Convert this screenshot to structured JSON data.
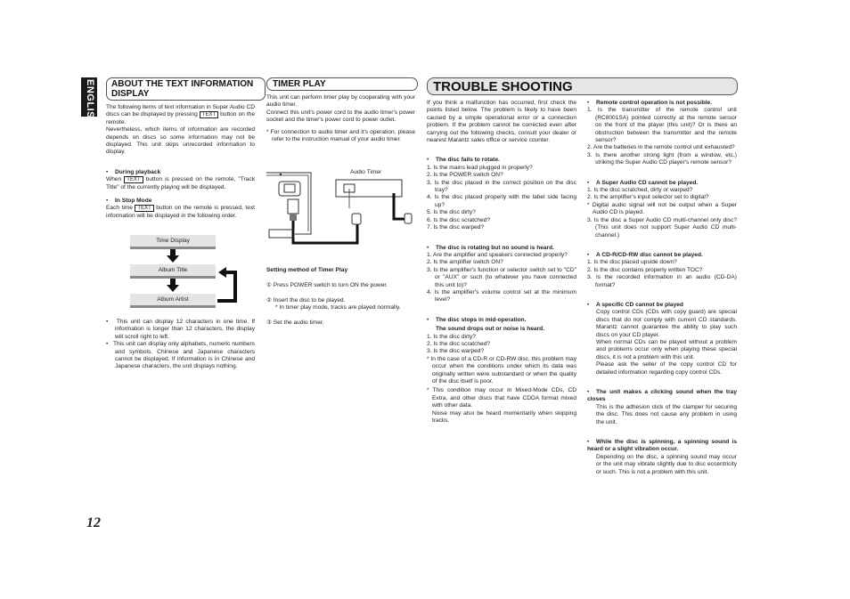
{
  "side_tab": {
    "label": "ENGLISH"
  },
  "page_number": "12",
  "text_info": {
    "title": "ABOUT THE TEXT INFORMATION DISPLAY",
    "intro_1a": "The following items of text information in Super Audio CD discs can be displayed by pressing",
    "key": "TEXT",
    "intro_1b": "button on the remote.",
    "intro_2": "Nevertheless, which items of information are recorded depends on discs so some information may not be displayed. This unit skips unrecorded information to display.",
    "playback_title": "During playback",
    "playback_a": "When",
    "playback_b": "button is pressed on the remote, \"Track Title\" of the currently playing will be displayed.",
    "stop_title": "In Stop Mode",
    "stop_a": "Each time",
    "stop_b": "button on the remote is pressed, text information will be displayed in the following order.",
    "flow": [
      "Time Display",
      "Album Title",
      "Album Artist"
    ],
    "notes": [
      "This unit can display 12 characters in one time. If information is longer than 12 characters, the display will scroll right to left.",
      "This unit can display only alphabets, numeric numbers and symbols. Chinese and Japanese characters cannot be displayed. If information is in Chinese and Japanese characters, the unit displays nothing."
    ]
  },
  "timer_play": {
    "title": "TIMER PLAY",
    "intro_1": "This unit can perform timer play by cooperating with your audio timer.",
    "intro_2": "Connect this unit's power cord to the audio timer's power socket and the timer's power cord to power outlet.",
    "note": "* For connection to audio timer and it's operation, please refer to the instruction manual of your audio timer.",
    "diagram_label": "Audio Timer",
    "method_title": "Setting method of Timer Play",
    "steps": [
      {
        "num": "①",
        "text": "Press POWER switch to turn ON the power."
      },
      {
        "num": "②",
        "text": "Insert the disc to be played."
      },
      {
        "num": "③",
        "text": "Set the audio timer."
      }
    ],
    "step2_note": "* In timer play mode, tracks are played normally."
  },
  "trouble": {
    "title": "TROUBLE SHOOTING",
    "intro": "If you think a malfunction has occurred, first check the points listed below. The problem is likely to have been caused by a simple operational error or a connection problem. If the problem cannot be corrected even after carrying out the following checks, consult your dealer or nearest Marantz sales office or service counter.",
    "s1": {
      "title": "The disc fails to rotate.",
      "items": [
        "1. Is the mains lead plugged in properly?",
        "2. Is the POWER switch ON?",
        "3. Is the disc placed in the correct position on the disc tray?",
        "4. Is the disc placed properly with the label side facing up?",
        "5. Is the disc dirty?",
        "6. Is the disc scratched?",
        "7. Is the disc warped?"
      ]
    },
    "s2": {
      "title": "The disc is rotating but no sound is heard.",
      "items": [
        "1. Are the amplifier and speakers connected properly?",
        "2. Is the amplifier switch ON?",
        "3. Is the amplifier's function or selector switch set to \"CD\" or \"AUX\" or such (to whatever you have connected this unit to)?",
        "4. Is the amplifier's volume control set at the minimum level?"
      ]
    },
    "s3": {
      "title": "The disc stops in mid-operation.",
      "title2": "The sound drops out or noise is heard.",
      "items": [
        "1. Is the disc dirty?",
        "2. Is the disc scratched?",
        "3. Is the disc warped?"
      ],
      "notes": [
        "* In the case of a CD-R or CD-RW disc, this problem may occur when the conditions under which its data was originally written were substandard or when the quality of the disc itself is poor.",
        "* This condition may occur in Mixed-Mode CDs, CD Extra, and other discs that have CDDA format mixed with other data."
      ],
      "extra": "Noise may also be heard momentarily when skipping tracks."
    },
    "s4": {
      "title": "Remote control operation is not possible.",
      "items": [
        "1. Is the transmitter of the remote control unit (RC8001SA) pointed correctly at the remote sensor on the front of the player (this unit)? Or is there an obstruction between the transmitter and the remote sensor?",
        "2. Are the batteries in the remote control unit exhausted?",
        "3. Is there another strong light (from a window, etc.) striking the Super Audio CD player's remote sensor?"
      ]
    },
    "s5": {
      "title": "A Super Audio CD cannot be played.",
      "items": [
        "1. Is the disc scratched, dirty or warped?",
        "2. Is the amplifier's input selector set to digital?"
      ],
      "note": "* Digital audio signal will not be output when a Super Audio CD is played.",
      "item3": "3. Is the disc a Super Audio CD multi-channel only disc? (This unit does not support Super Audio CD multi-channel.)"
    },
    "s6": {
      "title": "A CD-R/CD-RW disc cannot be played.",
      "items": [
        "1. Is the disc placed upside down?",
        "2. Is the disc contains properly written TOC?",
        "3. Is the recorded information in an audio (CD-DA) format?"
      ]
    },
    "s7": {
      "title": "A specific CD cannot be played",
      "paras": [
        "Copy control CDs (CDs with copy guard) are special discs that do not comply with current CD standards. Marantz cannot guarantee the ability to play such discs on your CD player.",
        "When normal CDs can be played without a problem and problems occur only when playing these special discs, it is not a problem with this unit.",
        "Please ask the seller of the copy control CD for detailed information regarding copy control CDs."
      ]
    },
    "s8": {
      "title": "The unit makes a clicking sound when the tray closes",
      "para": "This is the adhesion click of the clamper for securing the disc. This does not cause any problem in using the unit."
    },
    "s9": {
      "title": "While the disc is spinning, a spinning sound is heard or a slight vibration occur.",
      "para": "Depending on the disc, a spinning sound may occur or the unit may vibrate slightly due to disc eccentricity or such. This is not a problem with this unit."
    }
  }
}
